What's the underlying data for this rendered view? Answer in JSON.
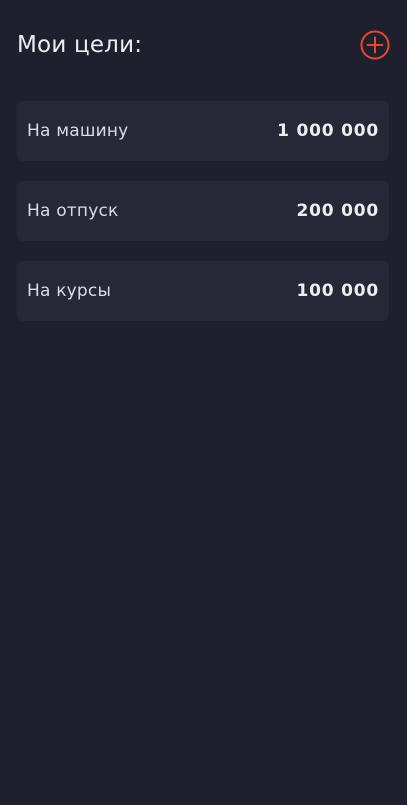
{
  "header": {
    "title": "Мои цели:",
    "add_icon": "plus-circle-icon",
    "accent_color": "#e8472d"
  },
  "goals": [
    {
      "name": "На машину",
      "amount": "1 000 000"
    },
    {
      "name": "На отпуск",
      "amount": "200 000"
    },
    {
      "name": "На курсы",
      "amount": "100 000"
    }
  ]
}
